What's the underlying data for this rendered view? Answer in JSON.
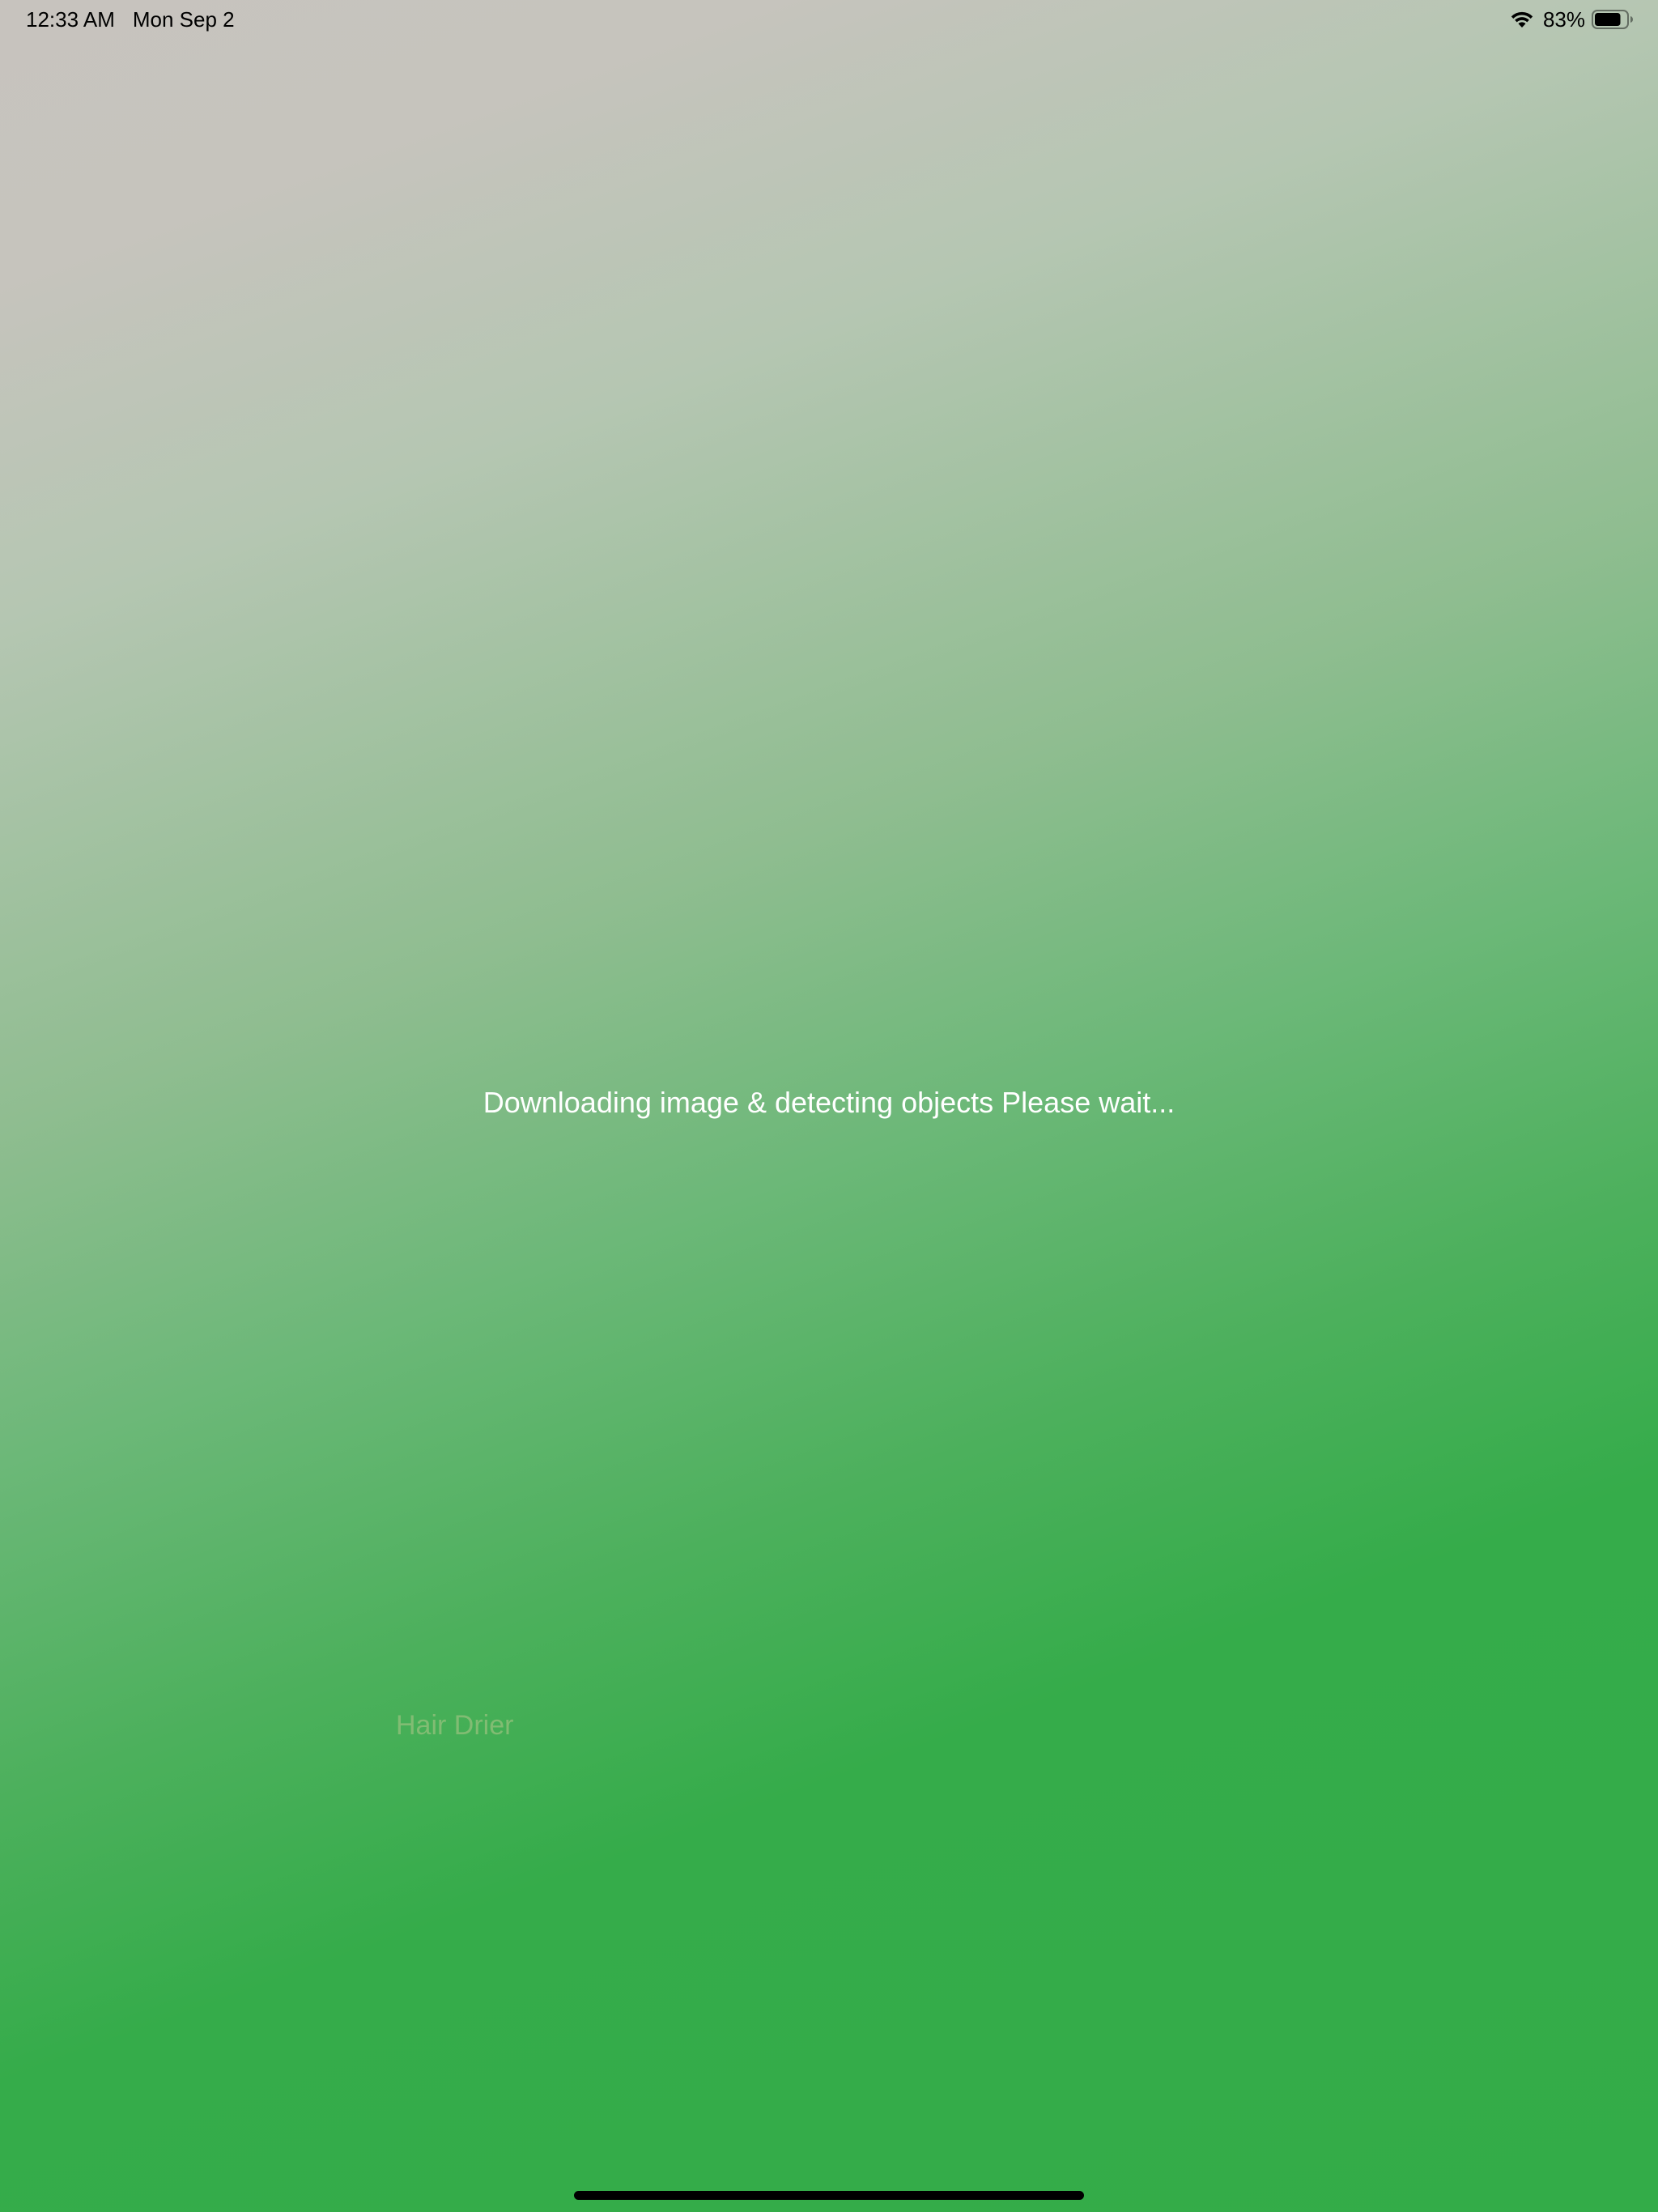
{
  "status_bar": {
    "time": "12:33 AM",
    "date": "Mon Sep 2",
    "battery_percent": "83%",
    "battery_level": 0.83,
    "icons": [
      "wifi-icon",
      "battery-icon"
    ]
  },
  "main": {
    "loading_message": "Downloading image & detecting objects Please wait...",
    "object_label": "Hair Drier"
  },
  "colors": {
    "gradient_top": "#c7c3be",
    "gradient_bottom": "#33ac48",
    "message_text": "#ffffff"
  }
}
